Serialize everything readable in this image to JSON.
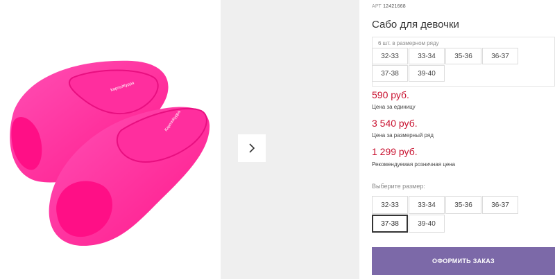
{
  "product": {
    "article_prefix": "АРТ",
    "article_number": "12421668",
    "title": "Сабо для девочки",
    "brand_print": "КарлоЖурра"
  },
  "size_row": {
    "label": "6 шт. в размерном ряду",
    "sizes": [
      "32-33",
      "33-34",
      "35-36",
      "36-37",
      "37-38",
      "39-40"
    ]
  },
  "prices": [
    {
      "amount": "590 руб.",
      "label": "Цена за единицу"
    },
    {
      "amount": "3 540 руб.",
      "label": "Цена за размерный ряд"
    },
    {
      "amount": "1 299 руб.",
      "label": "Рекомендуемая розничная цена"
    }
  ],
  "size_select": {
    "label": "Выберите размер:",
    "sizes": [
      "32-33",
      "33-34",
      "35-36",
      "36-37",
      "37-38",
      "39-40"
    ],
    "selected": "37-38"
  },
  "order_button": {
    "label": "ОФОРМИТЬ ЗАКАЗ"
  },
  "gallery": {
    "next_icon": "chevron-right-icon"
  },
  "colors": {
    "price": "#c8102e",
    "button": "#7c69a8",
    "product": "#ff1493"
  }
}
